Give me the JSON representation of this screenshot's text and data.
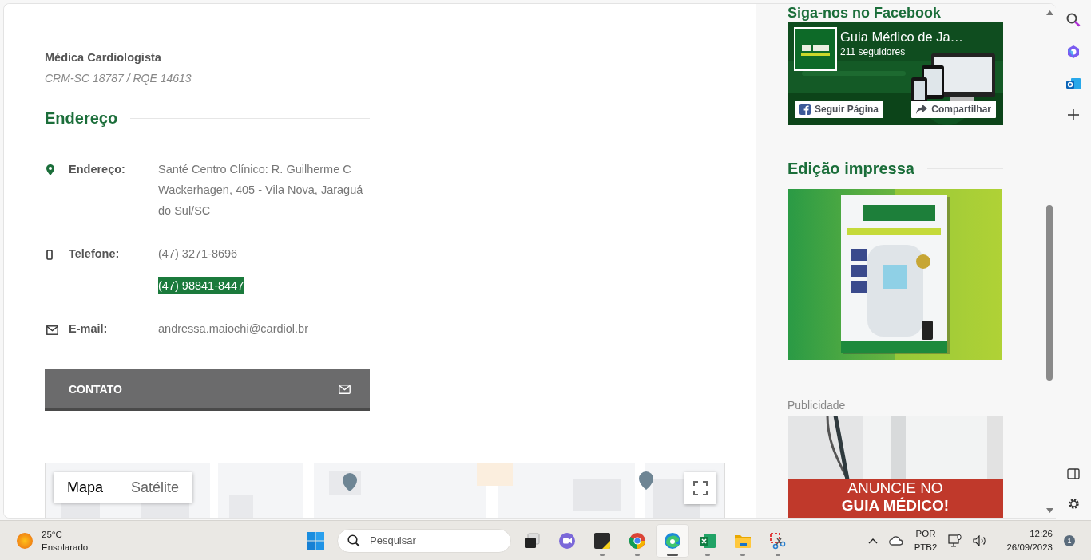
{
  "doctor": {
    "specialty": "Médica Cardiologista",
    "registration": "CRM-SC 18787 / RQE 14613"
  },
  "address_section": {
    "title": "Endereço",
    "rows": [
      {
        "kind": "address",
        "label": "Endereço:",
        "values": [
          {
            "text": "Santé Centro Clínico: R. Guilherme C Wackerhagen, 405 - Vila Nova, Jaraguá do Sul/SC",
            "highlighted": false
          }
        ]
      },
      {
        "kind": "phone",
        "label": "Telefone:",
        "values": [
          {
            "text": "(47) 3271-8696",
            "highlighted": false
          },
          {
            "text": "(47) 98841-8447",
            "highlighted": true
          }
        ]
      },
      {
        "kind": "email",
        "label": "E-mail:",
        "values": [
          {
            "text": "andressa.maiochi@cardiol.br",
            "highlighted": false
          }
        ]
      }
    ]
  },
  "contact_button": {
    "label": "CONTATO"
  },
  "map": {
    "map_types": [
      {
        "label": "Mapa",
        "selected": true
      },
      {
        "label": "Satélite",
        "selected": false
      }
    ]
  },
  "sidebar": {
    "facebook": {
      "title": "Siga-nos no Facebook",
      "page_name": "Guia Médico de Ja…",
      "followers": "211 seguidores",
      "buttons": [
        {
          "kind": "follow",
          "label": "Seguir Página"
        },
        {
          "kind": "share",
          "label": "Compartilhar"
        }
      ]
    },
    "print_edition": {
      "title": "Edição impressa"
    },
    "advertising": {
      "label": "Publicidade",
      "headline": [
        "ANUNCIE NO",
        "GUIA MÉDICO!"
      ]
    }
  },
  "taskbar": {
    "weather": {
      "temperature": "25°C",
      "condition": "Ensolarado"
    },
    "search": {
      "placeholder": "Pesquisar"
    },
    "apps": [
      {
        "kind": "task-view",
        "running": false,
        "selected": false
      },
      {
        "kind": "chat",
        "running": false,
        "selected": false
      },
      {
        "kind": "notes",
        "running": true,
        "selected": false
      },
      {
        "kind": "chrome",
        "running": true,
        "selected": false
      },
      {
        "kind": "edge",
        "running": true,
        "selected": true
      },
      {
        "kind": "excel",
        "running": true,
        "selected": false
      },
      {
        "kind": "explorer",
        "running": true,
        "selected": false
      },
      {
        "kind": "snipping",
        "running": true,
        "selected": false
      }
    ],
    "tray": {
      "language": "POR",
      "layout": "PTB2"
    },
    "clock": {
      "time": "12:26",
      "date": "26/09/2023"
    },
    "notifications": "1"
  }
}
